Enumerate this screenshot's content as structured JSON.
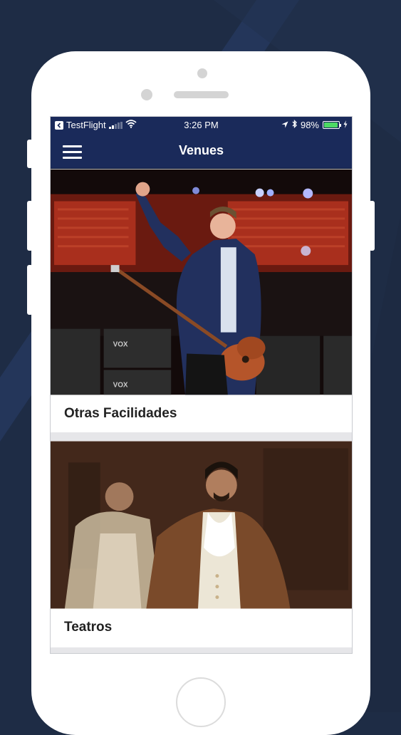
{
  "colors": {
    "background": "#1e2c45",
    "nav_bar": "#1a2a5a",
    "content_bg": "#e6e6e9",
    "battery_fill": "#4cd964"
  },
  "status_bar": {
    "carrier": "TestFlight",
    "time": "3:26 PM",
    "battery": "98%",
    "icons": [
      "back-to-app-icon",
      "signal-icon",
      "wifi-icon",
      "location-arrow-icon",
      "bluetooth-icon",
      "battery-icon",
      "charging-icon"
    ]
  },
  "nav": {
    "title": "Venues",
    "menu_icon": "hamburger-menu-icon"
  },
  "venues": [
    {
      "label": "Otras Facilidades",
      "image": "concert-performer-photo"
    },
    {
      "label": "Teatros",
      "image": "theater-actor-photo"
    }
  ]
}
